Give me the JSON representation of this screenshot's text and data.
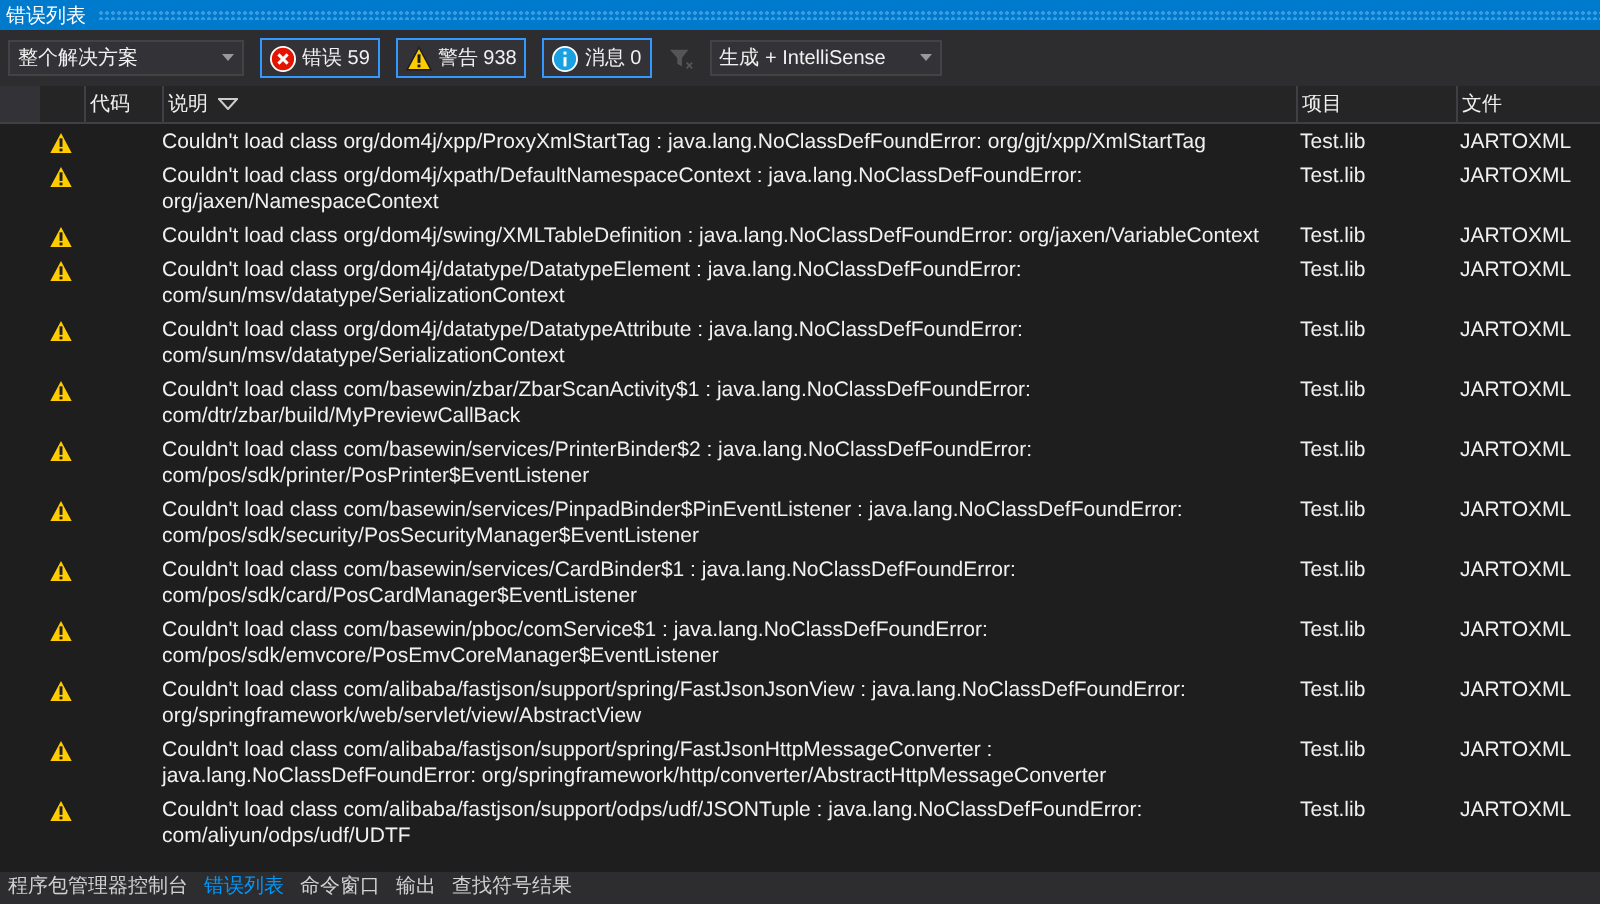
{
  "panel": {
    "title": "错误列表"
  },
  "toolbar": {
    "scope": "整个解决方案",
    "filters": [
      {
        "kind": "error",
        "label": "错误 59",
        "selected": true
      },
      {
        "kind": "warning",
        "label": "警告 938",
        "selected": true
      },
      {
        "kind": "info",
        "label": "消息 0",
        "selected": true
      }
    ],
    "source": "生成 + IntelliSense"
  },
  "table": {
    "columns": [
      {
        "label": "代码",
        "sorted": false
      },
      {
        "label": "说明",
        "sorted": true
      },
      {
        "label": "项目",
        "sorted": false
      },
      {
        "label": "文件",
        "sorted": false
      }
    ],
    "rows": [
      {
        "kind": "warning",
        "description": "Couldn't load class org/dom4j/xpp/ProxyXmlStartTag : java.lang.NoClassDefFoundError: org/gjt/xpp/XmlStartTag",
        "project": "Test.lib",
        "file": "JARTOXML"
      },
      {
        "kind": "warning",
        "description": "Couldn't load class org/dom4j/xpath/DefaultNamespaceContext : java.lang.NoClassDefFoundError: org/jaxen/NamespaceContext",
        "project": "Test.lib",
        "file": "JARTOXML"
      },
      {
        "kind": "warning",
        "description": "Couldn't load class org/dom4j/swing/XMLTableDefinition : java.lang.NoClassDefFoundError: org/jaxen/VariableContext",
        "project": "Test.lib",
        "file": "JARTOXML"
      },
      {
        "kind": "warning",
        "description": "Couldn't load class org/dom4j/datatype/DatatypeElement : java.lang.NoClassDefFoundError: com/sun/msv/datatype/SerializationContext",
        "project": "Test.lib",
        "file": "JARTOXML"
      },
      {
        "kind": "warning",
        "description": "Couldn't load class org/dom4j/datatype/DatatypeAttribute : java.lang.NoClassDefFoundError: com/sun/msv/datatype/SerializationContext",
        "project": "Test.lib",
        "file": "JARTOXML"
      },
      {
        "kind": "warning",
        "description": "Couldn't load class com/basewin/zbar/ZbarScanActivity$1 : java.lang.NoClassDefFoundError: com/dtr/zbar/build/MyPreviewCallBack",
        "project": "Test.lib",
        "file": "JARTOXML"
      },
      {
        "kind": "warning",
        "description": "Couldn't load class com/basewin/services/PrinterBinder$2 : java.lang.NoClassDefFoundError: com/pos/sdk/printer/PosPrinter$EventListener",
        "project": "Test.lib",
        "file": "JARTOXML"
      },
      {
        "kind": "warning",
        "description": "Couldn't load class com/basewin/services/PinpadBinder$PinEventListener : java.lang.NoClassDefFoundError: com/pos/sdk/security/PosSecurityManager$EventListener",
        "project": "Test.lib",
        "file": "JARTOXML"
      },
      {
        "kind": "warning",
        "description": "Couldn't load class com/basewin/services/CardBinder$1 : java.lang.NoClassDefFoundError: com/pos/sdk/card/PosCardManager$EventListener",
        "project": "Test.lib",
        "file": "JARTOXML"
      },
      {
        "kind": "warning",
        "description": "Couldn't load class com/basewin/pboc/comService$1 : java.lang.NoClassDefFoundError: com/pos/sdk/emvcore/PosEmvCoreManager$EventListener",
        "project": "Test.lib",
        "file": "JARTOXML"
      },
      {
        "kind": "warning",
        "description": "Couldn't load class com/alibaba/fastjson/support/spring/FastJsonJsonView : java.lang.NoClassDefFoundError: org/springframework/web/servlet/view/AbstractView",
        "project": "Test.lib",
        "file": "JARTOXML"
      },
      {
        "kind": "warning",
        "description": "Couldn't load class com/alibaba/fastjson/support/spring/FastJsonHttpMessageConverter : java.lang.NoClassDefFoundError: org/springframework/http/converter/AbstractHttpMessageConverter",
        "project": "Test.lib",
        "file": "JARTOXML"
      },
      {
        "kind": "warning",
        "description": "Couldn't load class com/alibaba/fastjson/support/odps/udf/JSONTuple : java.lang.NoClassDefFoundError: com/aliyun/odps/udf/UDTF",
        "project": "Test.lib",
        "file": "JARTOXML"
      }
    ]
  },
  "bottom_tabs": [
    {
      "label": "程序包管理器控制台",
      "selected": false
    },
    {
      "label": "错误列表",
      "selected": true
    },
    {
      "label": "命令窗口",
      "selected": false
    },
    {
      "label": "输出",
      "selected": false
    },
    {
      "label": "查找符号结果",
      "selected": false
    }
  ]
}
